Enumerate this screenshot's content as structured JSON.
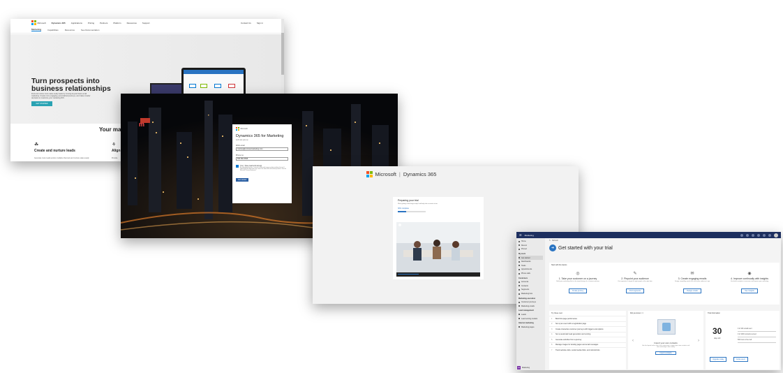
{
  "marketing_site": {
    "brand": "Microsoft",
    "product": "Dynamics 365",
    "nav": [
      "Applications",
      "Pricing",
      "Partners",
      "Platform",
      "Resources",
      "Support"
    ],
    "nav_right": [
      "Contact Us",
      "Sign in"
    ],
    "subnav": [
      "Marketing",
      "Capabilities",
      "Resources",
      "See Documentation"
    ],
    "hero_title": "Turn prospects into business relationships",
    "hero_body": "Find and nurture more sales-ready leads by moving beyond basic email marketing. Create more engaging, personalized journeys, and make smarter decisions to maximize your marketing ROI.",
    "hero_button": "GET STARTED",
    "section_title": "Your mark",
    "features": [
      {
        "title": "Create and nurture leads",
        "sub": "Generate more leads across multiple channels and nurture sales-ready"
      },
      {
        "title": "Align",
        "sub": "Provide"
      }
    ]
  },
  "signup": {
    "brand": "Microsoft",
    "title": "Dynamics 365 for Marketing",
    "subtitle": "Let's set you up",
    "email_label": "Work email",
    "email_value": "marissa@contosomarketing.com",
    "phone_label": "Phone no.",
    "phone_value": "555 555 5555",
    "consent_title": "Yes, I have read and accept",
    "consent_body": "By submitting this form, I consent to Microsoft using my data to deliver this trial. I understand that Microsoft may contact me about this and related products. See the Microsoft Privacy Statement.",
    "submit": "Get started"
  },
  "preparing": {
    "brand": "Microsoft",
    "product": "Dynamics 365",
    "title": "Preparing your trial",
    "subtitle": "We're getting a few things ready. It will only take a minute or two.",
    "progress_label": "30% complete",
    "progress_pct": 30
  },
  "app": {
    "app_name": "Marketing",
    "command": "Refresh",
    "page_title": "Get started with your trial",
    "basics_label": "Start with the basics",
    "steps": [
      {
        "icon": "◎",
        "title": "1. Take your customer on a journey",
        "desc": "Build your marketing effort in the simple design of a customer journey",
        "button": "Create journey"
      },
      {
        "icon": "✎",
        "title": "2. Pinpoint your audience",
        "desc": "Use segments to target the right people at the right time",
        "button": "Find segments"
      },
      {
        "icon": "✉",
        "title": "3. Create engaging emails",
        "desc": "Design compelling emails that catch your audience's eye",
        "button": "Design emails"
      },
      {
        "icon": "◉",
        "title": "4. Improve continually with insights",
        "desc": "Use built-in analytics to measure and improve your marketing",
        "button": "See insights"
      }
    ],
    "sidebar": [
      {
        "label": "Home",
        "head": false,
        "sel": false
      },
      {
        "label": "Recent",
        "head": false,
        "sel": false
      },
      {
        "label": "Pinned",
        "head": false,
        "sel": false
      },
      {
        "label": "My work",
        "head": true,
        "sel": false
      },
      {
        "label": "Get started",
        "head": false,
        "sel": true
      },
      {
        "label": "Dashboards",
        "head": false,
        "sel": false
      },
      {
        "label": "Tasks",
        "head": false,
        "sel": false
      },
      {
        "label": "Appointments",
        "head": false,
        "sel": false
      },
      {
        "label": "Phone calls",
        "head": false,
        "sel": false
      },
      {
        "label": "Customers",
        "head": true,
        "sel": false
      },
      {
        "label": "Accounts",
        "head": false,
        "sel": false
      },
      {
        "label": "Contacts",
        "head": false,
        "sel": false
      },
      {
        "label": "Segments",
        "head": false,
        "sel": false
      },
      {
        "label": "Marketing lists",
        "head": false,
        "sel": false
      },
      {
        "label": "Marketing execution",
        "head": true,
        "sel": false
      },
      {
        "label": "Customer journeys",
        "head": false,
        "sel": false
      },
      {
        "label": "Marketing emails",
        "head": false,
        "sel": false
      },
      {
        "label": "Lead management",
        "head": true,
        "sel": false
      },
      {
        "label": "Leads",
        "head": false,
        "sel": false
      },
      {
        "label": "Lead scoring models",
        "head": false,
        "sel": false
      },
      {
        "label": "Internet marketing",
        "head": true,
        "sel": false
      },
      {
        "label": "Marketing pages",
        "head": false,
        "sel": false
      }
    ],
    "area_badge": "MA",
    "area_label": "Marketing",
    "next_steps_title": "Try these next",
    "next_steps": [
      "Build link page performance",
      "Set up an event with a registration page",
      "Create interactive customer journeys with triggers and options",
      "Set up automatic lead generation and scoring",
      "Generate activities from a journey",
      "Manage images for landing pages and email messages",
      "Track website visits, social media clicks, and referral links"
    ],
    "did_you_know_title": "Did you know",
    "did_you_know_count": "1/2",
    "import_title": "Import your own contacts",
    "import_desc": "Use the Import tool or one of our connectors to import your own contacts and start marketing to them today.",
    "import_button": "Import contacts",
    "trial_title": "Trial information",
    "days": "30",
    "days_label": "days left",
    "trial_lines": [
      "0 of 100 emails sent",
      "0 of 1000 contacts synced",
      "500 hours of tier left"
    ],
    "trial_actions": [
      "Upgrade today",
      "Invite users"
    ]
  }
}
